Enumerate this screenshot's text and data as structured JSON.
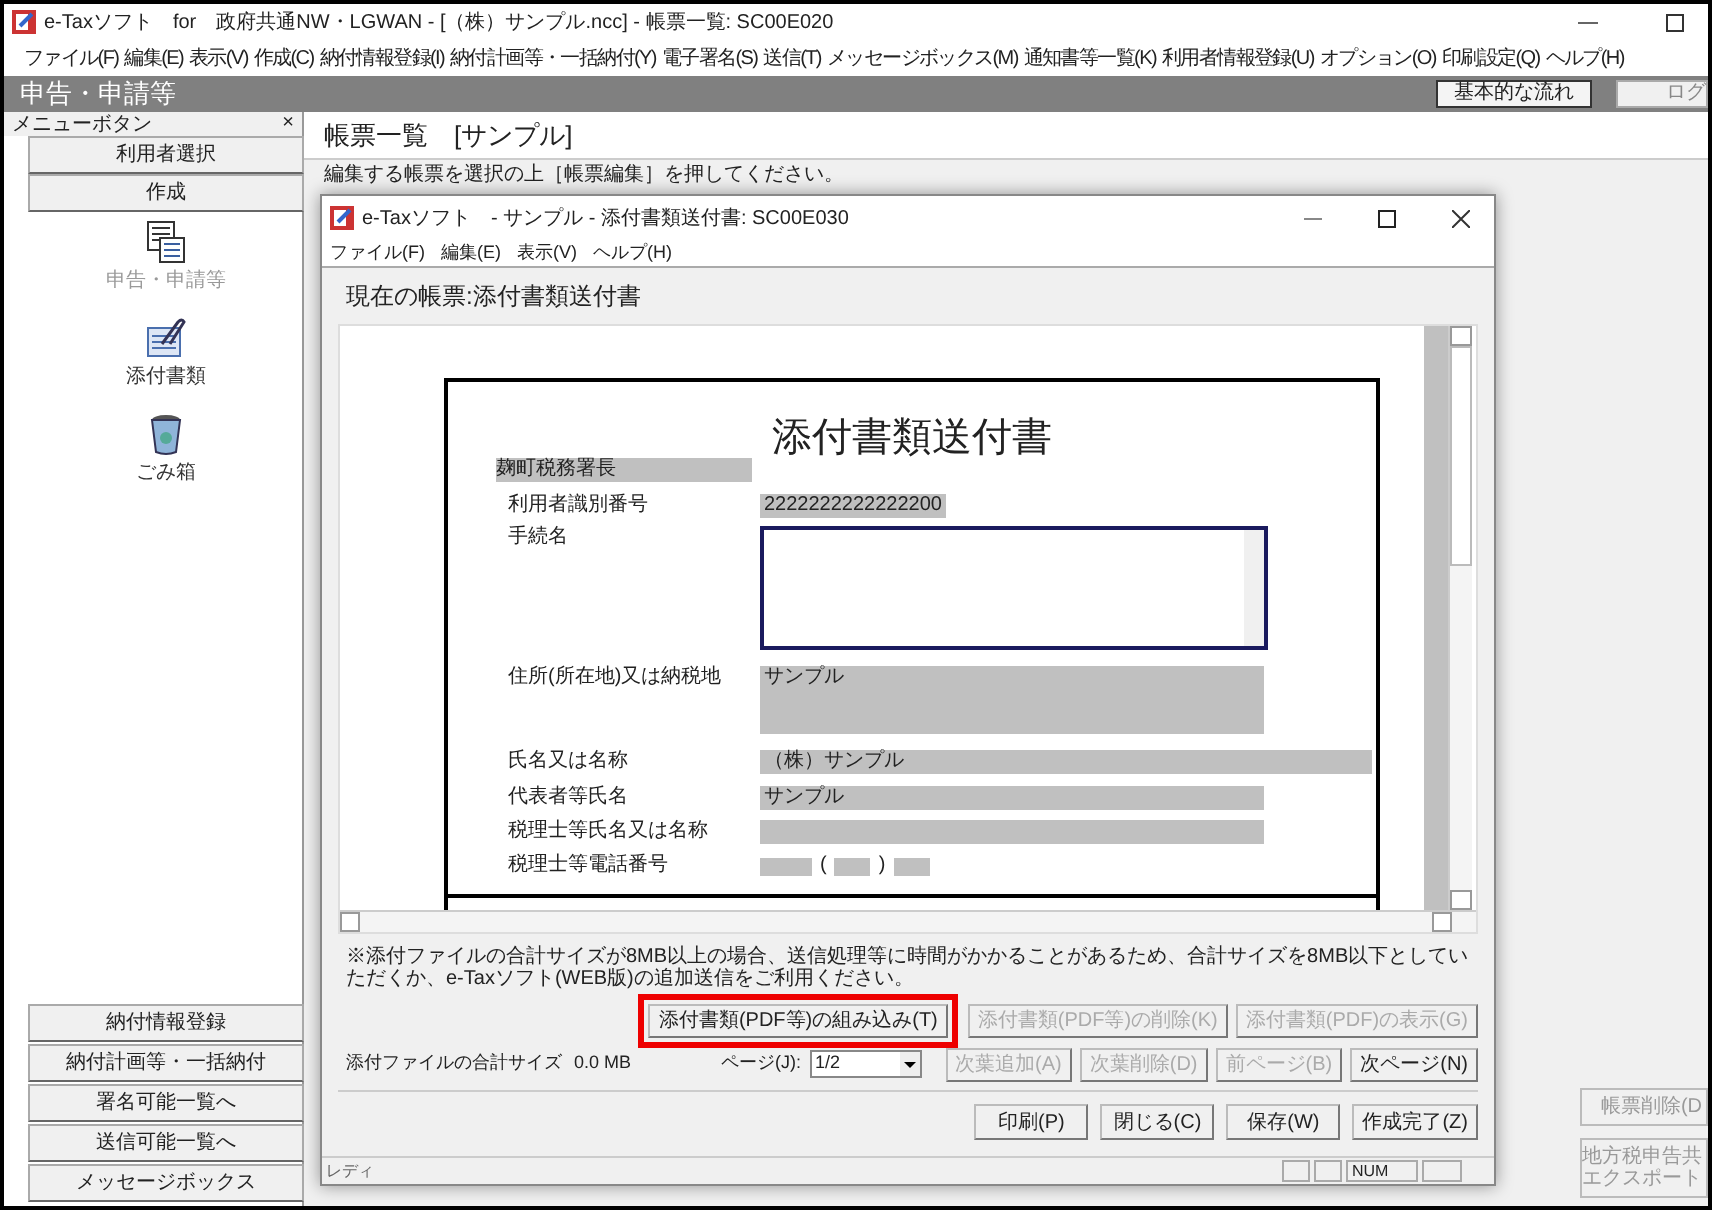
{
  "window": {
    "title": "e-Taxソフト　for　政府共通NW・LGWAN - [（株）サンプル.ncc] - 帳票一覧: SC00E020"
  },
  "menu": [
    "ファイル(F)",
    "編集(E)",
    "表示(V)",
    "作成(C)",
    "納付情報登録(I)",
    "納付計画等・一括納付(Y)",
    "電子署名(S)",
    "送信(T)",
    "メッセージボックス(M)",
    "通知書等一覧(K)",
    "利用者情報登録(U)",
    "オプション(O)",
    "印刷設定(Q)",
    "ヘルプ(H)"
  ],
  "header": {
    "title": "申告・申請等",
    "buttons": [
      "基本的な流れ",
      "ログ"
    ]
  },
  "sidebar": {
    "title": "メニューボタン",
    "close": "×",
    "top_buttons": [
      "利用者選択",
      "作成"
    ],
    "icons": [
      {
        "kind": "forms",
        "label": "申告・申請等",
        "disabled": true
      },
      {
        "kind": "attach",
        "label": "添付書類",
        "disabled": false
      },
      {
        "kind": "trash",
        "label": "ごみ箱",
        "disabled": false
      }
    ],
    "bottom_buttons": [
      "納付情報登録",
      "納付計画等・一括納付",
      "署名可能一覧へ",
      "送信可能一覧へ",
      "メッセージボックス"
    ]
  },
  "main": {
    "title": "帳票一覧　[サンプル]",
    "instruction": "編集する帳票を選択の上［帳票編集］を押してください。",
    "buttons": [
      "帳票削除(D",
      "地方税申告共エクスポート"
    ]
  },
  "dialog": {
    "title": "e-Taxソフト　- サンプル - 添付書類送付書: SC00E030",
    "menu": [
      "ファイル(F)",
      "編集(E)",
      "表示(V)",
      "ヘルプ(H)"
    ],
    "current_form": "現在の帳票:添付書類送付書",
    "paper": {
      "title": "添付書類送付書",
      "office": "麹町税務署長",
      "fields": [
        {
          "kind": "short",
          "label": "利用者識別番号",
          "value": "2222222222222200"
        },
        {
          "kind": "textarea",
          "label": "手続名"
        },
        {
          "kind": "tall",
          "label": "住所(所在地)又は納税地",
          "value": "サンプル"
        },
        {
          "kind": "wide",
          "label": "氏名又は名称",
          "value": "（株）サンプル"
        },
        {
          "kind": "line",
          "label": "代表者等氏名",
          "value": "サンプル"
        },
        {
          "kind": "line",
          "label": "税理士等氏名又は名称"
        },
        {
          "kind": "phone",
          "label": "税理士等電話番号",
          "parts": [
            "(",
            ")"
          ]
        }
      ]
    },
    "note": "※添付ファイルの合計サイズが8MB以上の場合、送信処理等に時間がかかることがあるため、合計サイズを8MB以下としていただくか、e-Taxソフト(WEB版)の追加送信をご利用ください。",
    "attach_buttons": [
      {
        "label": "添付書類(PDF等)の組み込み(T)",
        "disabled": false,
        "highlighted": true
      },
      {
        "label": "添付書類(PDF等)の削除(K)",
        "disabled": true,
        "highlighted": false
      },
      {
        "label": "添付書類(PDF)の表示(G)",
        "disabled": true,
        "highlighted": false
      }
    ],
    "total_size_label": "添付ファイルの合計サイズ",
    "total_size": "0.0 MB",
    "page_label": "ページ(J):",
    "page_value": "1/2",
    "page_buttons": [
      {
        "label": "次葉追加(A)",
        "disabled": true
      },
      {
        "label": "次葉削除(D)",
        "disabled": true
      },
      {
        "label": "前ページ(B)",
        "disabled": true
      },
      {
        "label": "次ページ(N)",
        "disabled": false
      }
    ],
    "action_buttons": [
      "印刷(P)",
      "閉じる(C)",
      "保存(W)",
      "作成完了(Z)"
    ],
    "status": [
      "レディ",
      "NUM"
    ]
  }
}
